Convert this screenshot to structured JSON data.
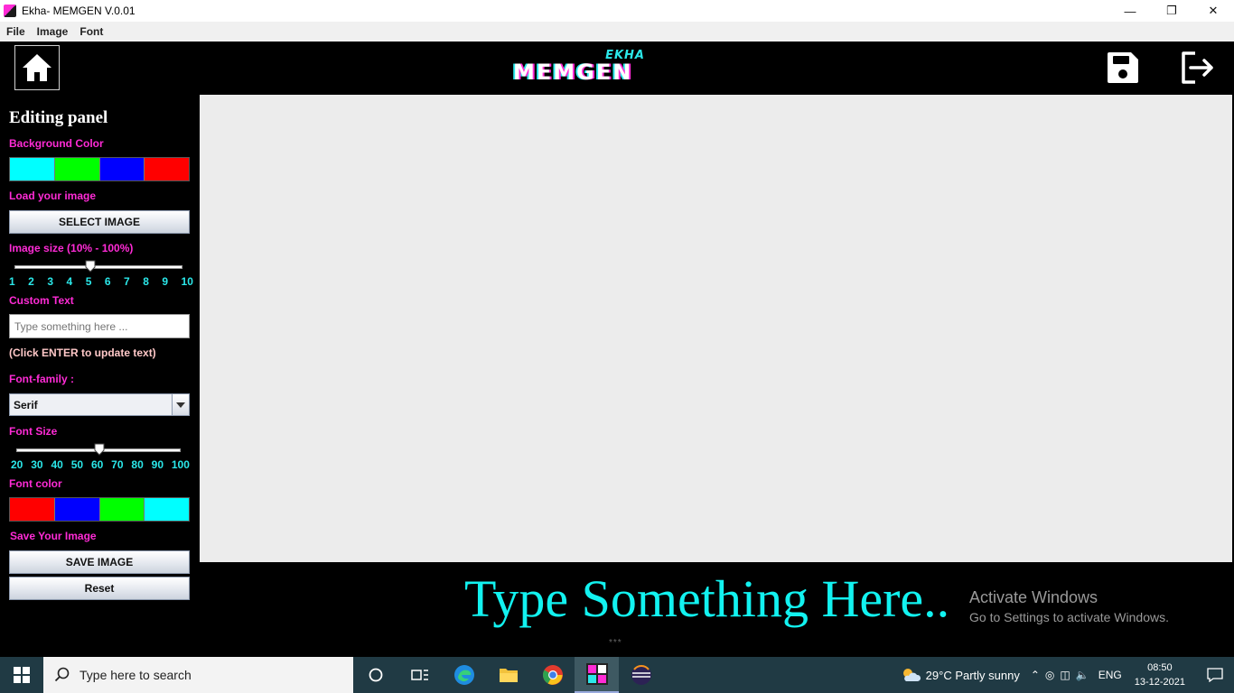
{
  "window": {
    "title": "Ekha- MEMGEN V.0.01",
    "minimize": "—",
    "restore": "❐",
    "close": "✕"
  },
  "menu": [
    "File",
    "Image",
    "Font"
  ],
  "header": {
    "logo_top": "EKHA",
    "logo_main": "MEMGEN"
  },
  "panel": {
    "title": "Editing panel",
    "background_color_label": "Background Color",
    "background_colors": [
      "#00ffff",
      "#00ff00",
      "#0000ff",
      "#ff0000"
    ],
    "load_image_label": "Load your image",
    "select_image_button": "SELECT IMAGE",
    "image_size_label": "Image size (10% - 100%)",
    "image_size_ticks": [
      "1",
      "2",
      "3",
      "4",
      "5",
      "6",
      "7",
      "8",
      "9",
      "10"
    ],
    "image_size_value": 5,
    "custom_text_label": "Custom Text",
    "custom_text_placeholder": "Type something here ...",
    "custom_text_hint": "(Click ENTER to update text)",
    "font_family_label": "Font-family :",
    "font_family_value": "Serif",
    "font_size_label": "Font Size",
    "font_size_ticks": [
      "20",
      "30",
      "40",
      "50",
      "60",
      "70",
      "80",
      "90",
      "100"
    ],
    "font_size_value": 60,
    "font_color_label": "Font color",
    "font_colors": [
      "#ff0000",
      "#0000ff",
      "#00ff00",
      "#00ffff"
    ],
    "save_label": "Save Your Image",
    "save_button": "SAVE IMAGE",
    "reset_button": "Reset"
  },
  "preview": {
    "meme_text": "Type Something Here..",
    "meme_text_color": "#12f2f0",
    "canvas_color": "#ececec",
    "handle": "***"
  },
  "watermark": {
    "title": "Activate Windows",
    "subtitle": "Go to Settings to activate Windows."
  },
  "taskbar": {
    "search_placeholder": "Type here to search",
    "weather": "29°C  Partly sunny",
    "language": "ENG",
    "time": "08:50",
    "date": "13-12-2021"
  }
}
